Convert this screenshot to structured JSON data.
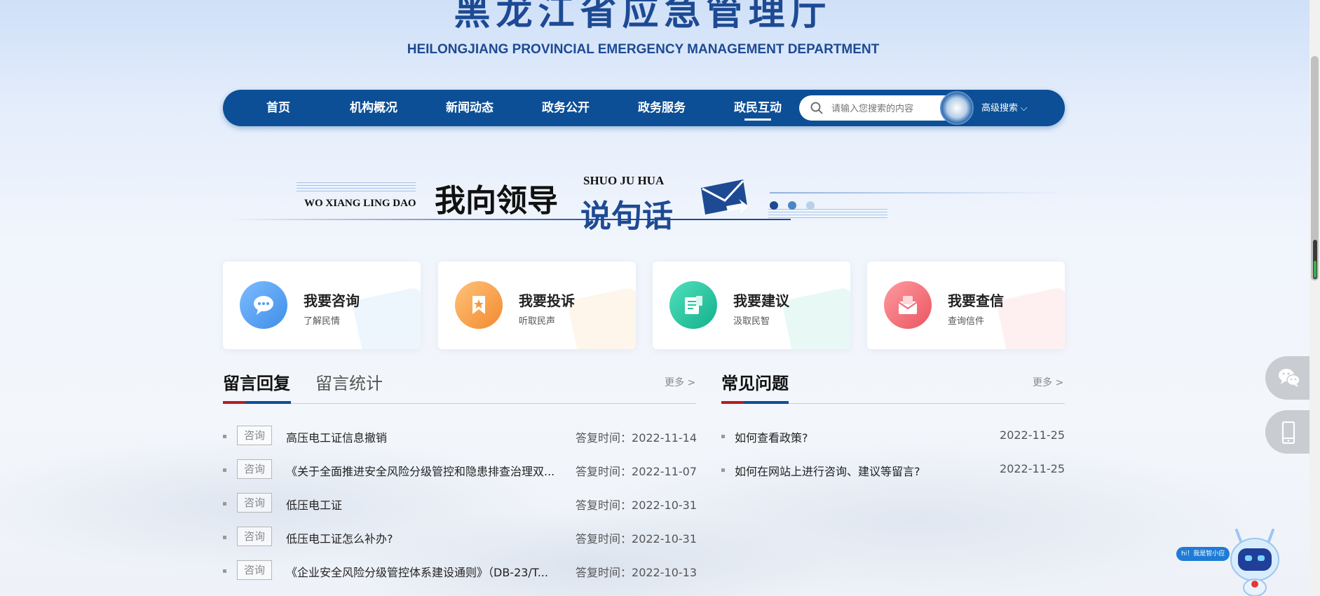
{
  "header": {
    "title": "黑龙江省应急管理厅",
    "subtitle": "HEILONGJIANG PROVINCIAL EMERGENCY MANAGEMENT DEPARTMENT"
  },
  "nav": {
    "items": [
      {
        "label": "首页"
      },
      {
        "label": "机构概况"
      },
      {
        "label": "新闻动态"
      },
      {
        "label": "政务公开"
      },
      {
        "label": "政务服务"
      },
      {
        "label": "政民互动"
      }
    ],
    "active": "政民互动",
    "search_placeholder": "请输入您搜索的内容",
    "advanced_search": "高级搜索",
    "accent_color": "#0c4f96"
  },
  "banner": {
    "pinyin_left": "WO XIANG LING DAO",
    "chinese_left": "我向领导",
    "pinyin_right": "SHUO JU HUA",
    "chinese_right": "说句话"
  },
  "cards": [
    {
      "title": "我要咨询",
      "sub": "了解民情",
      "color": "#4f9cf0",
      "icon": "chat-bubble-icon"
    },
    {
      "title": "我要投诉",
      "sub": "听取民声",
      "color": "#f59a3c",
      "icon": "bookmark-star-icon"
    },
    {
      "title": "我要建议",
      "sub": "汲取民智",
      "color": "#21c6a0",
      "icon": "document-icon"
    },
    {
      "title": "我要查信",
      "sub": "查询信件",
      "color": "#f26b74",
      "icon": "envelope-icon"
    }
  ],
  "messages": {
    "tab_active": "留言回复",
    "tab_inactive": "留言统计",
    "more": "更多 >",
    "reply_prefix": "答复时间：",
    "rows": [
      {
        "tag": "咨询",
        "title": "高压电工证信息撤销",
        "date": "2022-11-14"
      },
      {
        "tag": "咨询",
        "title": "《关于全面推进安全风险分级管控和隐患排查治理双...",
        "date": "2022-11-07"
      },
      {
        "tag": "咨询",
        "title": "低压电工证",
        "date": "2022-10-31"
      },
      {
        "tag": "咨询",
        "title": "低压电工证怎么补办?",
        "date": "2022-10-31"
      },
      {
        "tag": "咨询",
        "title": "《企业安全风险分级管控体系建设通则》（DB-23/T...",
        "date": "2022-10-13"
      }
    ]
  },
  "faq": {
    "title": "常见问题",
    "more": "更多 >",
    "rows": [
      {
        "title": "如何查看政策?",
        "date": "2022-11-25"
      },
      {
        "title": "如何在网站上进行咨询、建议等留言?",
        "date": "2022-11-25"
      }
    ]
  },
  "assistant": {
    "bubble": "hi！我是智小应"
  }
}
